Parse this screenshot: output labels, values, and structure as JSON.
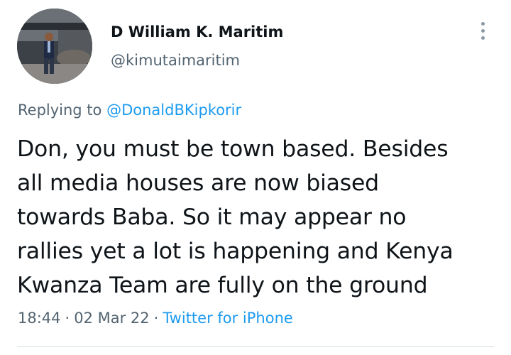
{
  "author": {
    "name": "D William K. Maritim",
    "handle": "@kimutaimaritim",
    "avatar_icon": "profile-photo"
  },
  "more_icon": "more-options-icon",
  "reply": {
    "prefix": "Replying to ",
    "mention": "@DonaldBKipkorir"
  },
  "tweet": {
    "lines": [
      "Don, you must be town based. Besides",
      "all media houses are now biased",
      "towards Baba. So it may appear no",
      "rallies yet a lot is happening and Kenya",
      "Kwanza Team are fully on the ground"
    ]
  },
  "meta": {
    "time": "18:44",
    "separator": "·",
    "date": "02 Mar 22",
    "source": "Twitter for iPhone"
  },
  "colors": {
    "text": "#0f1419",
    "secondary": "#536471",
    "link": "#1d9bf0",
    "divider": "#cfd9de"
  }
}
